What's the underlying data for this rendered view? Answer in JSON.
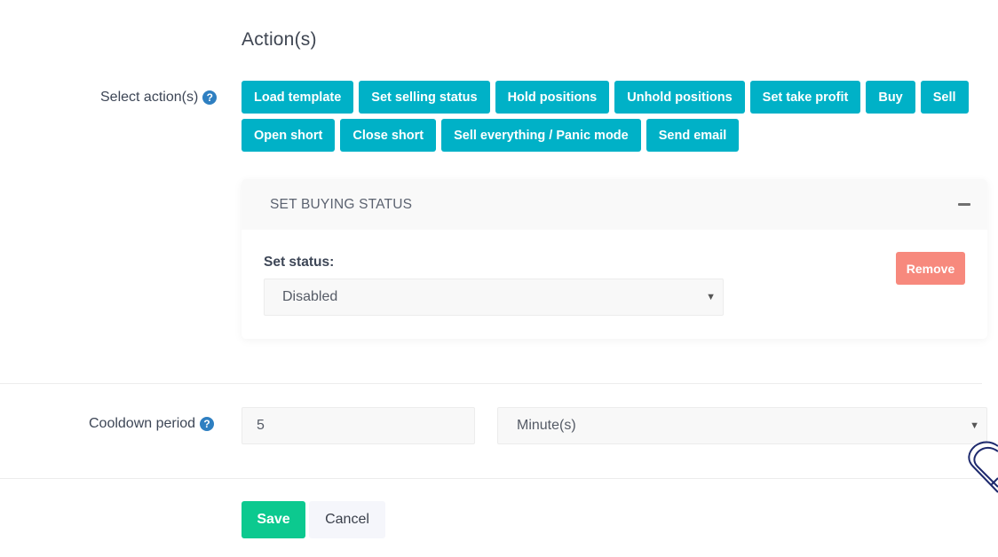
{
  "section": {
    "title": "Action(s)"
  },
  "select_actions": {
    "label": "Select action(s)",
    "help_icon": "question-circle-icon",
    "buttons_row1": [
      "Load template",
      "Set selling status",
      "Hold positions",
      "Unhold positions",
      "Set take profit",
      "Buy",
      "Sell"
    ],
    "buttons_row2": [
      "Open short",
      "Close short",
      "Sell everything / Panic mode",
      "Send email"
    ]
  },
  "panel": {
    "title": "SET BUYING STATUS",
    "collapse_icon": "minus-icon",
    "field_label": "Set status:",
    "status_value": "Disabled",
    "remove_label": "Remove"
  },
  "cooldown": {
    "label": "Cooldown period",
    "help_icon": "question-circle-icon",
    "value": "5",
    "unit": "Minute(s)"
  },
  "footer": {
    "save_label": "Save",
    "cancel_label": "Cancel"
  },
  "colors": {
    "action_button": "#00b1c7",
    "remove_button": "#f7897d",
    "save_button": "#0cc98f",
    "help_icon": "#2e7fc1"
  }
}
